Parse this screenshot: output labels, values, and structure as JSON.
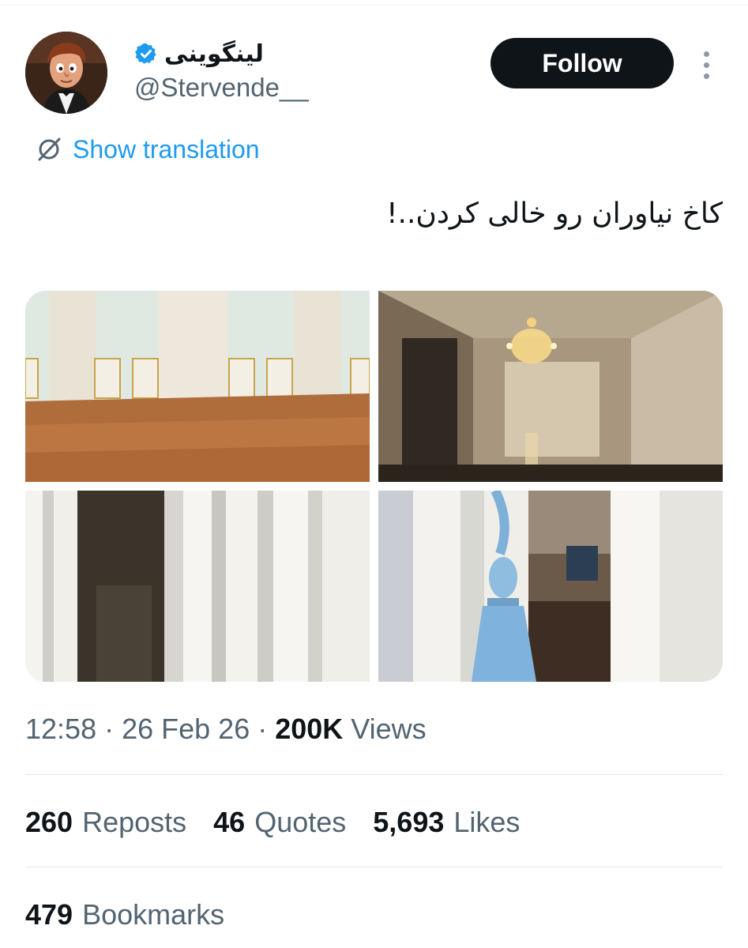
{
  "author": {
    "display_name": "لینگوینی",
    "handle": "@Stervende__",
    "verified": true,
    "avatar_icon": "avatar-cartoon-chef"
  },
  "header": {
    "follow_label": "Follow",
    "more_icon": "more-vertical-icon"
  },
  "translation": {
    "label": "Show translation",
    "icon": "translate-icon"
  },
  "tweet": {
    "text": "کاخ نیاوران رو خالی کردن..!"
  },
  "media": [
    {
      "icon": "photo-empty-hall"
    },
    {
      "icon": "photo-chandelier-corridor"
    },
    {
      "icon": "photo-white-curtains"
    },
    {
      "icon": "photo-curtain-tassel"
    }
  ],
  "meta": {
    "time": "12:58",
    "sep1": " · ",
    "date": "26 Feb 26",
    "sep2": " · ",
    "views_count": "200K",
    "views_label": " Views"
  },
  "stats": {
    "reposts_count": "260",
    "reposts_label": "Reposts",
    "quotes_count": "46",
    "quotes_label": "Quotes",
    "likes_count": "5,693",
    "likes_label": "Likes",
    "bookmarks_count": "479",
    "bookmarks_label": "Bookmarks"
  },
  "colors": {
    "text_primary": "#0f1419",
    "text_secondary": "#536471",
    "link": "#1d9bf0",
    "verified": "#1d9bf0",
    "button_bg": "#0f1419"
  }
}
